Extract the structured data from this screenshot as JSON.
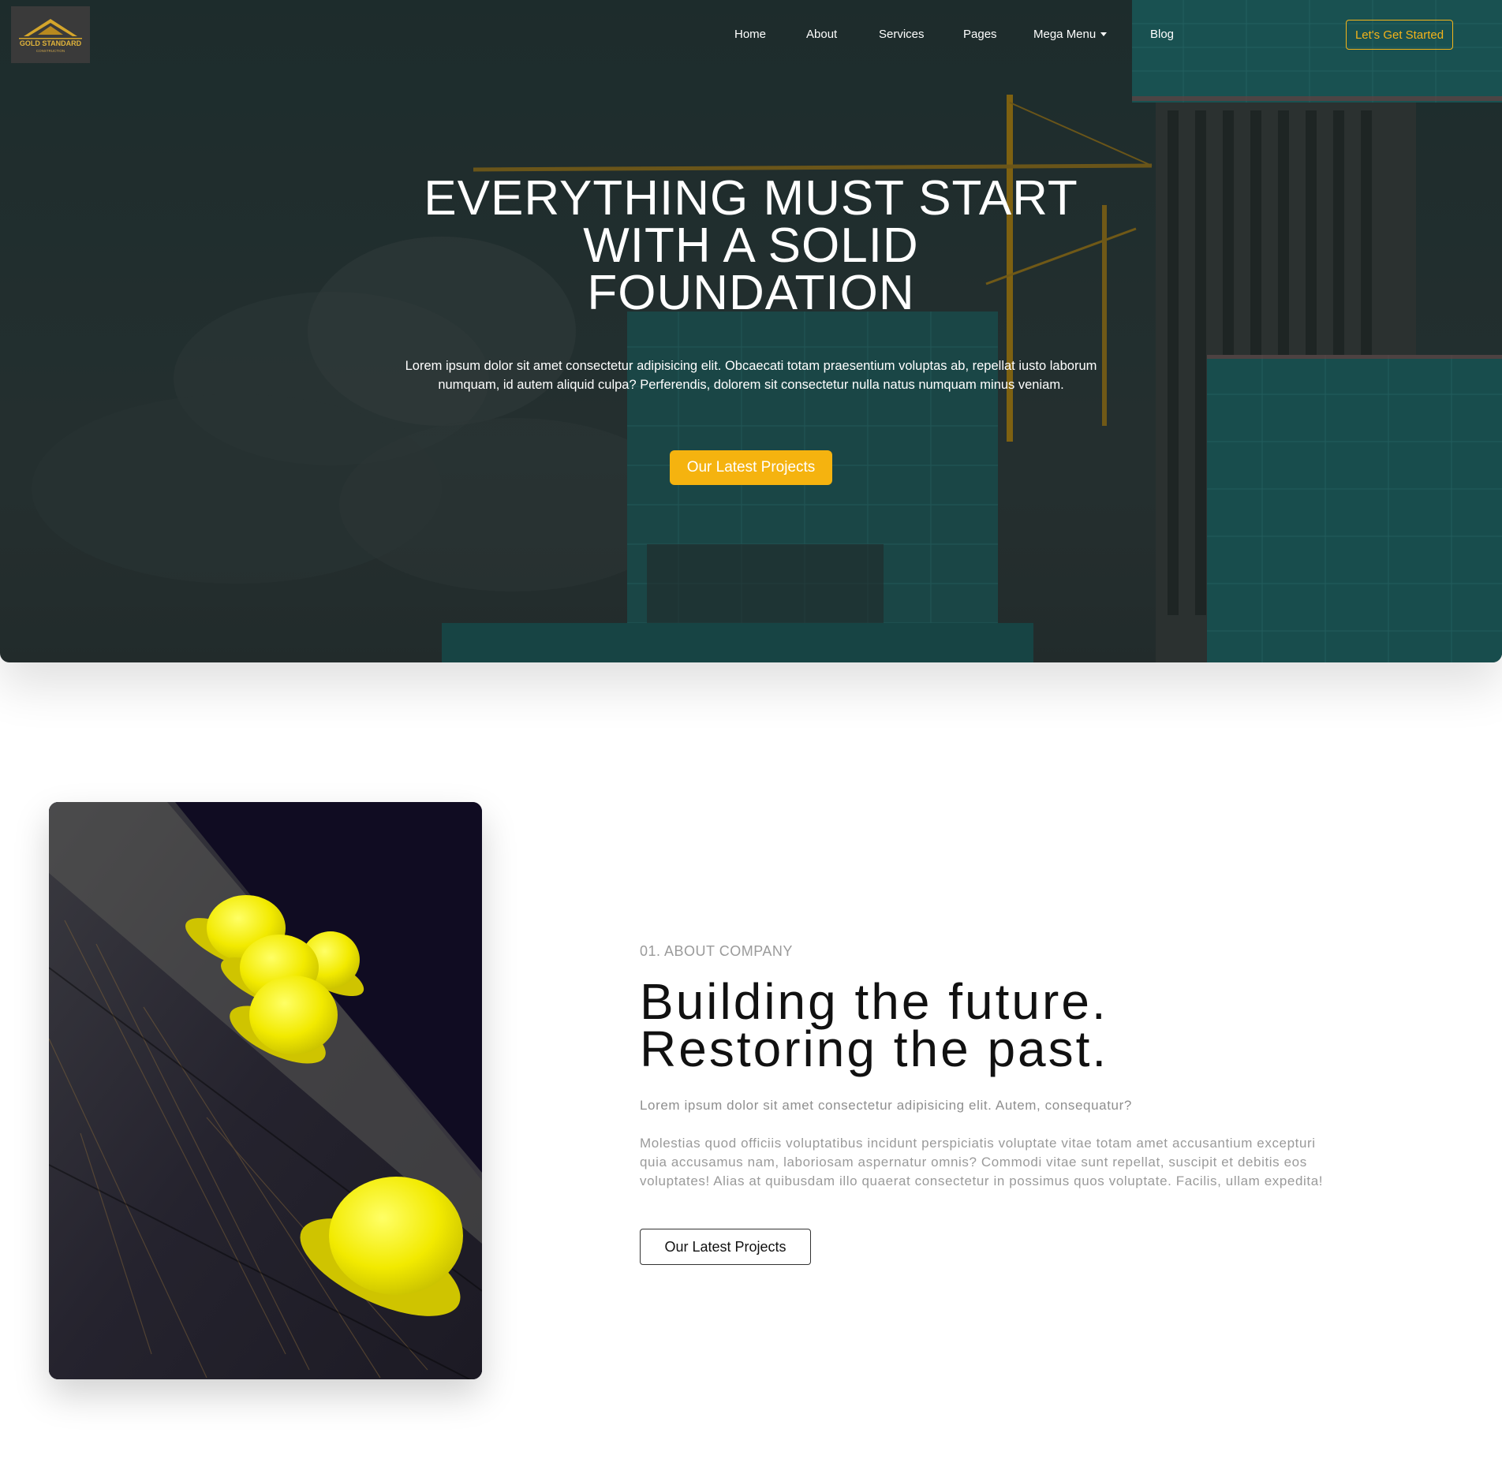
{
  "brand": {
    "logo_text": "GOLD STANDARD",
    "logo_subtext": "CONSTRUCTION"
  },
  "nav": {
    "items": [
      {
        "label": "Home"
      },
      {
        "label": "About"
      },
      {
        "label": "Services"
      },
      {
        "label": "Pages"
      },
      {
        "label": "Mega Menu"
      },
      {
        "label": "Blog"
      }
    ],
    "cta_label": "Let's Get Started"
  },
  "hero": {
    "title_line1": "EVERYTHING MUST START",
    "title_line2": "WITH A SOLID",
    "title_line3": "FOUNDATION",
    "text": "Lorem ipsum dolor sit amet consectetur adipisicing elit. Obcaecati totam praesentium voluptas ab, repellat iusto laborum numquam, id autem aliquid culpa? Perferendis, dolorem sit consectetur nulla natus numquam minus veniam.",
    "button_label": "Our Latest Projects"
  },
  "about": {
    "eyebrow": "01. ABOUT COMPANY",
    "title_line1": "Building the future.",
    "title_line2": "Restoring the past.",
    "lead": "Lorem ipsum dolor sit amet consectetur adipisicing elit. Autem, consequatur?",
    "body": "Molestias quod officiis voluptatibus incidunt perspiciatis voluptate vitae totam amet accusantium excepturi quia accusamus nam, laboriosam aspernatur omnis? Commodi vitae sunt repellat, suscipit et debitis eos voluptates! Alias at quibusdam illo quaerat consectetur in possimus quos voluptate. Facilis, ullam expedita!",
    "button_label": "Our Latest Projects"
  },
  "colors": {
    "accent": "#f5b30f",
    "hero_dark": "#243535",
    "glass_teal": "#1f6868"
  }
}
